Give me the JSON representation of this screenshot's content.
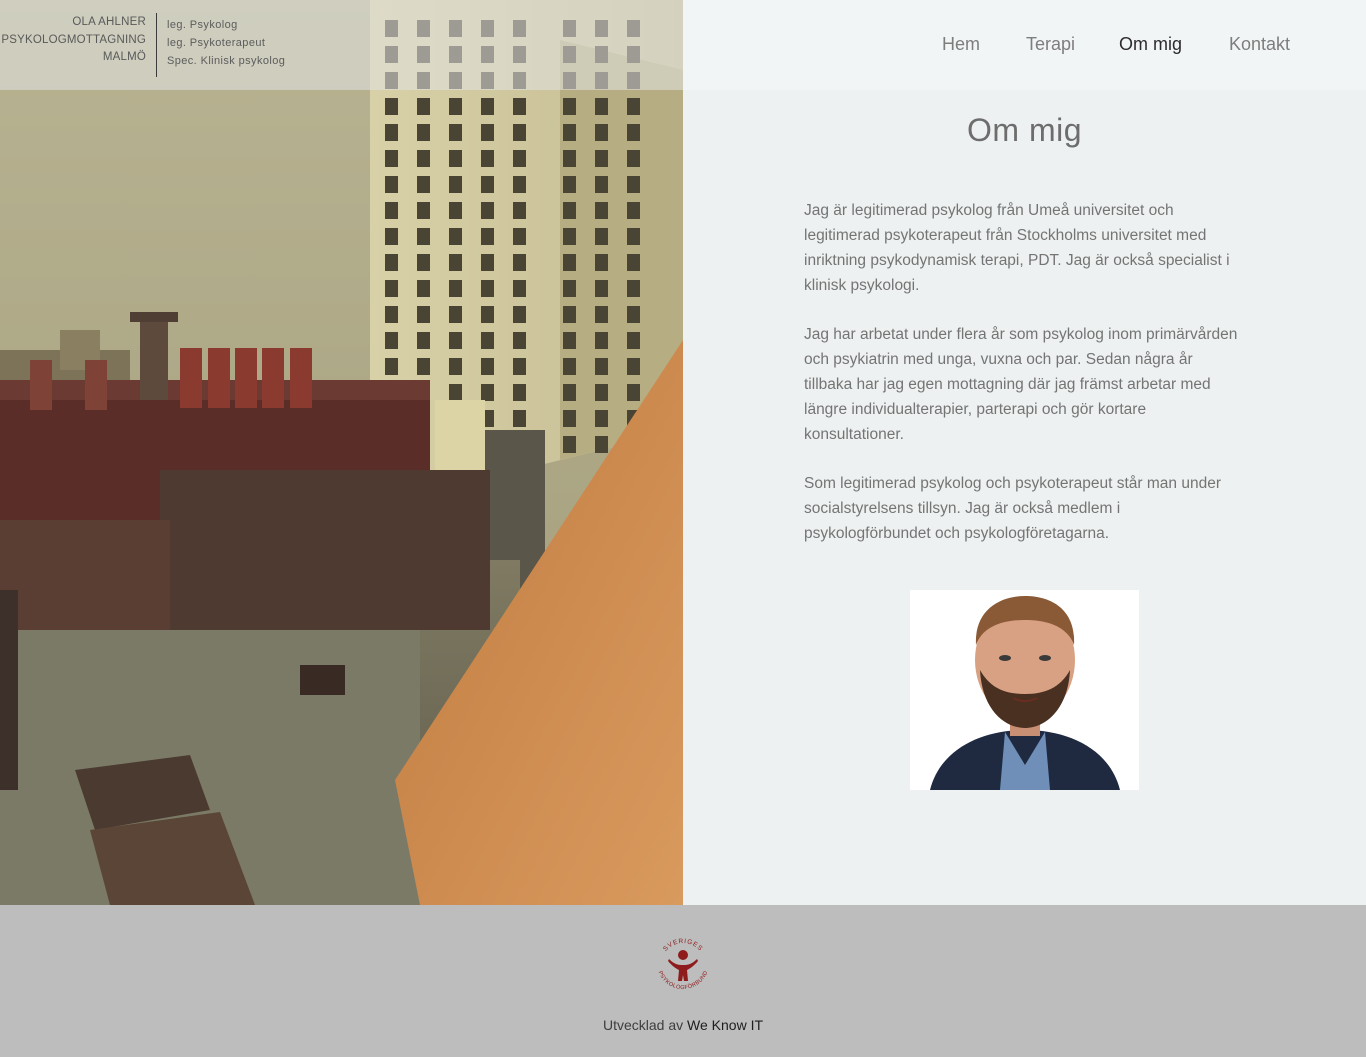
{
  "brand": {
    "name": "OLA AHLNER",
    "line2": "PSYKOLOGMOTTAGNING",
    "city": "MALMÖ"
  },
  "titles": [
    "leg. Psykolog",
    "leg. Psykoterapeut",
    "Spec. Klinisk psykolog"
  ],
  "nav": [
    {
      "label": "Hem",
      "active": false
    },
    {
      "label": "Terapi",
      "active": false
    },
    {
      "label": "Om mig",
      "active": true
    },
    {
      "label": "Kontakt",
      "active": false
    }
  ],
  "page": {
    "title": "Om mig",
    "paragraphs": [
      "Jag är legitimerad psykolog från Umeå universitet och legitimerad psykoterapeut från Stockholms universitet med inriktning psykodynamisk terapi, PDT. Jag är också specialist i klinisk psykologi.",
      "Jag har arbetat under flera år som psykolog inom primärvården och psykiatrin med unga, vuxna och par. Sedan några år tillbaka har jag egen mottagning där jag främst arbetar med längre individualterapier, parterapi och gör kortare konsultationer.",
      "Som legitimerad psykolog och psykoterapeut står man under socialstyrelsens tillsyn. Jag är också medlem i psykologförbundet och psykologföretagarna."
    ]
  },
  "footer": {
    "badge_top": "SVERIGES",
    "badge_bottom": "PSYKOLOGFÖRBUND",
    "credit_prefix": "Utvecklad av",
    "credit_link": "We Know IT"
  },
  "colors": {
    "badge": "#8e1c1c",
    "nav_active": "#2c2c2c",
    "footer_bg": "#bdbdbd"
  }
}
